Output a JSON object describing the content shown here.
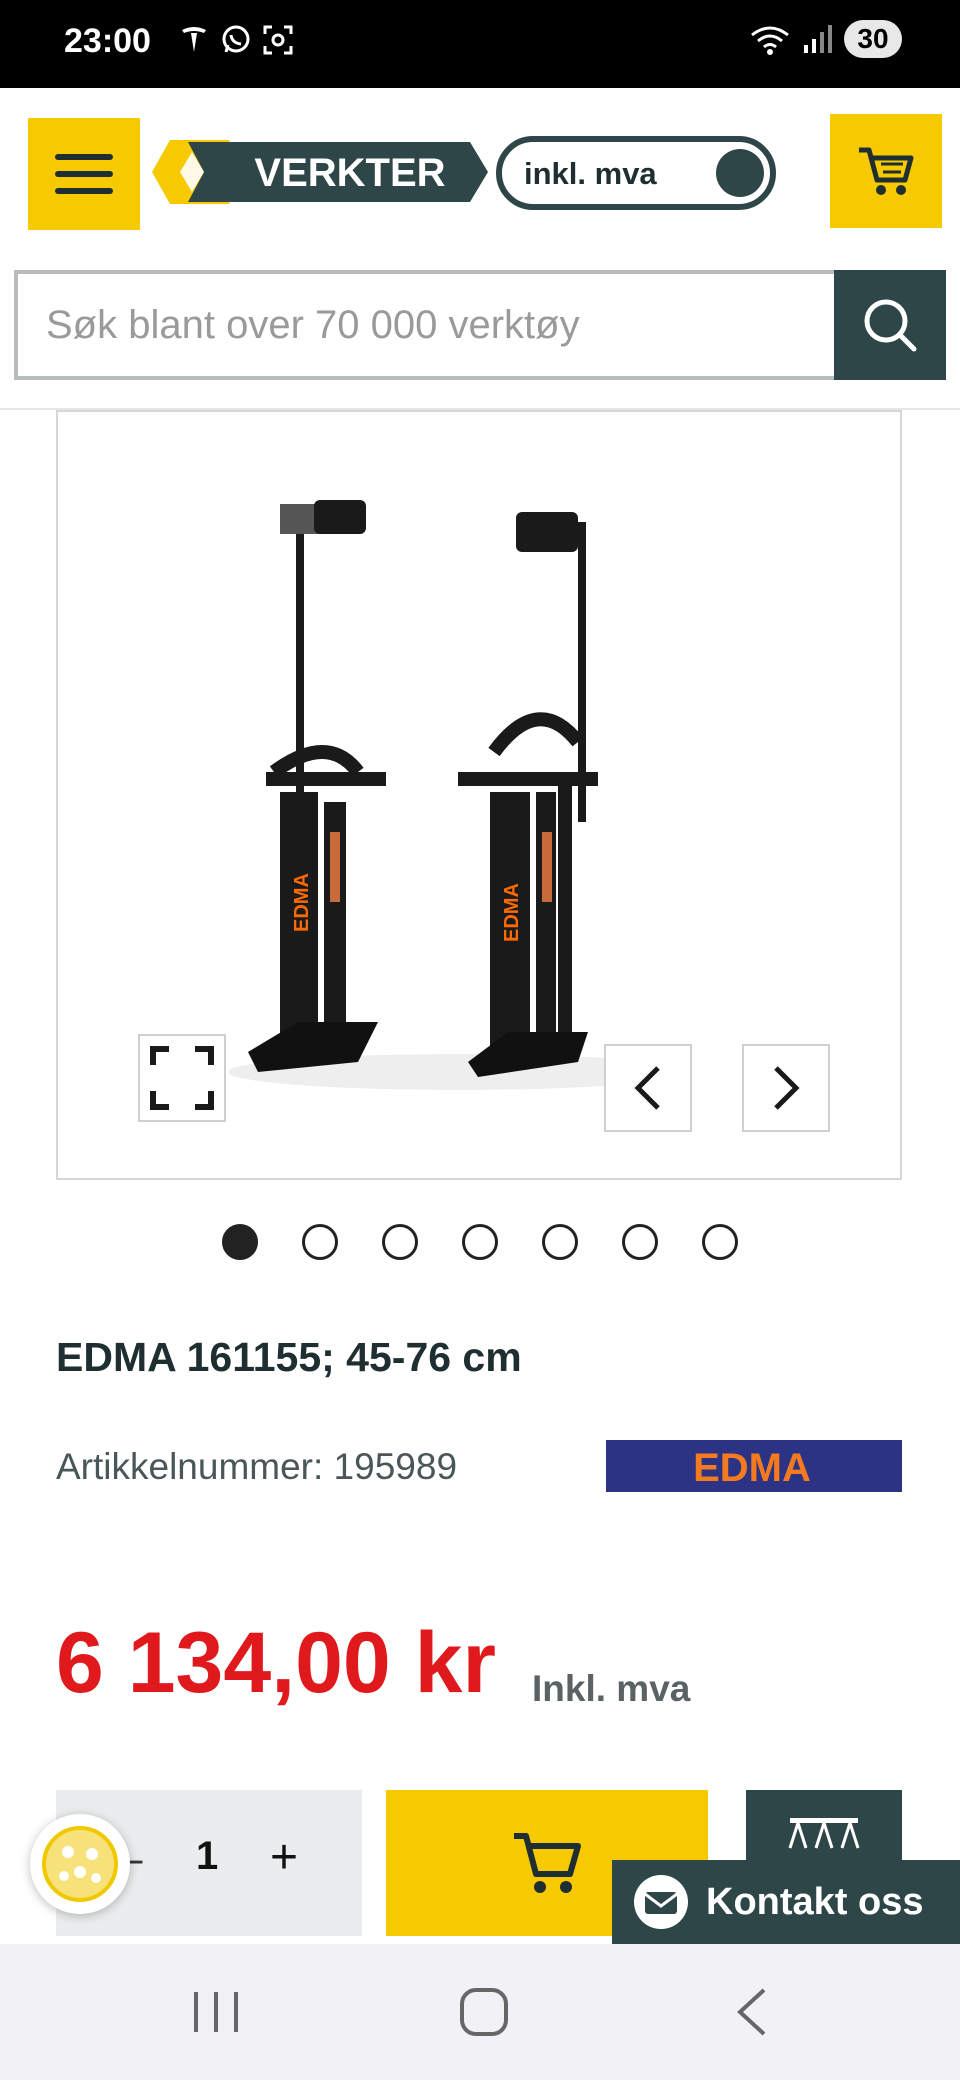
{
  "status_bar": {
    "time": "23:00",
    "battery": "30"
  },
  "header": {
    "logo_text": "VERKTER",
    "vat_toggle_label": "inkl. mva"
  },
  "search": {
    "placeholder": "Søk blant over 70 000 verktøy",
    "value": ""
  },
  "gallery": {
    "image_count": 7,
    "active_index": 0
  },
  "product": {
    "title": "EDMA 161155; 45-76 cm",
    "article_number": "Artikkelnummer: 195989",
    "brand": "EDMA",
    "price": "6 134,00 kr",
    "price_suffix": "Inkl. mva"
  },
  "quantity": {
    "minus": "–",
    "value": "1",
    "plus": "+"
  },
  "contact": {
    "label": "Kontakt oss"
  },
  "colors": {
    "accent_yellow": "#f7c900",
    "dark_teal": "#2f4648",
    "price_red": "#e0191c"
  }
}
